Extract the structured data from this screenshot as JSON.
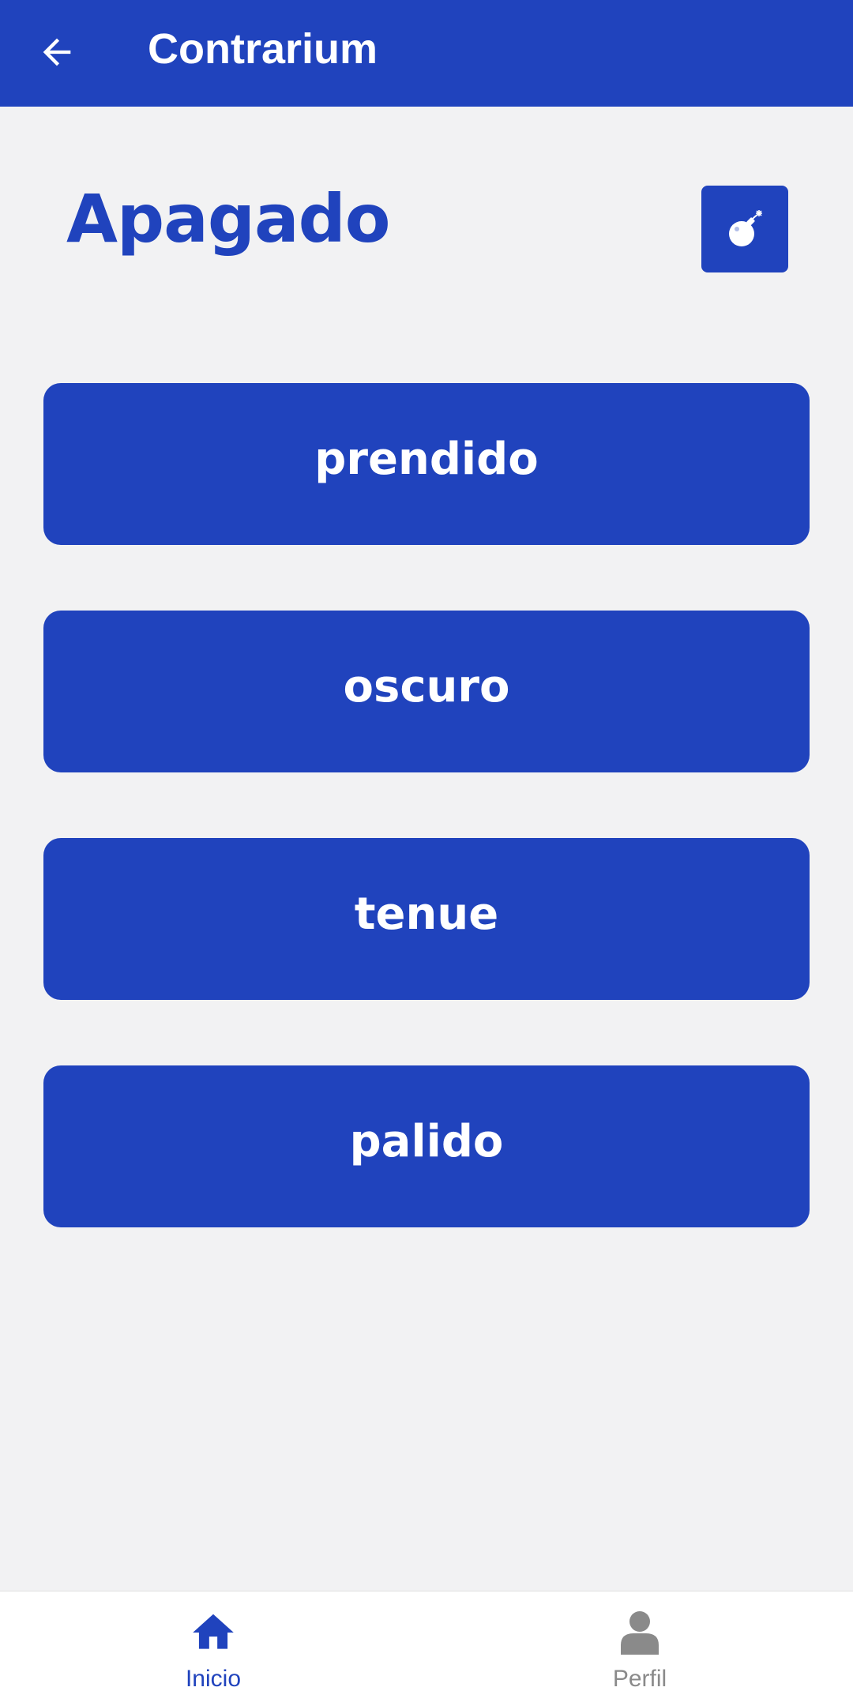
{
  "colors": {
    "primary": "#2043bd",
    "background": "#f2f2f3",
    "on_primary": "#ffffff",
    "inactive": "#8a8a8a"
  },
  "appbar": {
    "back_icon": "arrow-left-icon",
    "title": "Contrarium"
  },
  "question": {
    "word": "Apagado",
    "hint_button_icon": "bomb-icon"
  },
  "options": [
    {
      "label": "prendido"
    },
    {
      "label": "oscuro"
    },
    {
      "label": "tenue"
    },
    {
      "label": "palido"
    }
  ],
  "bottom_nav": {
    "items": [
      {
        "label": "Inicio",
        "icon": "home-icon",
        "active": true
      },
      {
        "label": "Perfil",
        "icon": "person-icon",
        "active": false
      }
    ]
  }
}
